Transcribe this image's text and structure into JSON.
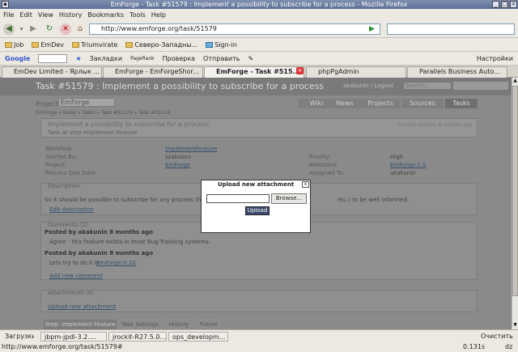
{
  "window": {
    "title": "EmForge - Task #51579 : Implement a possibility to subscribe for a process - Mozilla Firefox"
  },
  "menu": [
    "File",
    "Edit",
    "View",
    "History",
    "Bookmarks",
    "Tools",
    "Help"
  ],
  "nav": {
    "url": "http://www.emforge.org/task/51579"
  },
  "bookmarks": [
    "Job",
    "EmDev",
    "Triumvirate",
    "Северо-Западны...",
    "Sign-in"
  ],
  "googlebar": {
    "google": "Google",
    "bookmarks_label": "Закладки",
    "pagerank": "PageRank",
    "check": "Проверка",
    "send": "Отправить",
    "settings": "Настройки"
  },
  "tabs": [
    "EmDev Limited - Ярлык ...",
    "EmForge - EmForgeShor...",
    "EmForge - Task #515...",
    "phpPgAdmin",
    "Parallels Business Auto..."
  ],
  "page": {
    "heading": "Task #51579 : Implement a possibility to subscribe for a process",
    "user": "akakunin | Logout",
    "search_placeholder": "Search...",
    "project_label": "Project:",
    "project_value": "EmForge",
    "site_tabs": [
      "Wiki",
      "News",
      "Projects",
      "Sources",
      "Tasks"
    ],
    "breadcrumb": "EmForge » Roles » Tasks » Task #51579 » Task #51579",
    "process_title": "Implement a possibility to subscribe for a process",
    "process_status": "Process Started: 8 months ago",
    "step_label": "Task at step Implement Feature",
    "fields": {
      "workflow_label": "Workflow:",
      "workflow": "ImplementFeature",
      "started_label": "Started By:",
      "started": "szakusov",
      "project_label": "Project:",
      "project": "EmForge",
      "due_label": "Process Due Date:",
      "priority_label": "Priority:",
      "priority": "High",
      "milestone_label": "Milestone:",
      "milestone": "EmForge-1.0",
      "assigned_label": "Assigned To:",
      "assigned": "akakunin"
    },
    "description_hdr": "Description",
    "description": "So it should be possible to subscribe for any process (for ev",
    "description_tail": "etc.) to be well informed.",
    "edit_description": "Edit description",
    "comments_hdr": "Comments (2)",
    "comment1_by": "Posted by akakunin 8 months ago",
    "comment1": "Agree - this feature exists in most Bug-Tracking systems.",
    "comment2_by": "Posted by akakunin 8 months ago",
    "comment2": "Lets try to do it in",
    "comment2_link": "EmForge-0.20",
    "add_comment": "Add new comment",
    "attachments_hdr": "Attachments (0)",
    "upload_link": "Upload new attachment",
    "bottom_tabs": [
      "Step: Implement Feature",
      "Task Settings",
      "History",
      "Future"
    ]
  },
  "dialog": {
    "title": "Upload new attachment",
    "browse": "Browse...",
    "upload": "Upload",
    "close": "x"
  },
  "status": {
    "downloads": "Загрузки",
    "tasks": [
      "jbpm-jpdl-3.2....",
      "jrockit-R27.5.0...",
      "ops_developm..."
    ],
    "clear": "Очистить",
    "url": "http://www.emforge.org/task/51579#",
    "time": "0.131s",
    "zone": "dz"
  }
}
